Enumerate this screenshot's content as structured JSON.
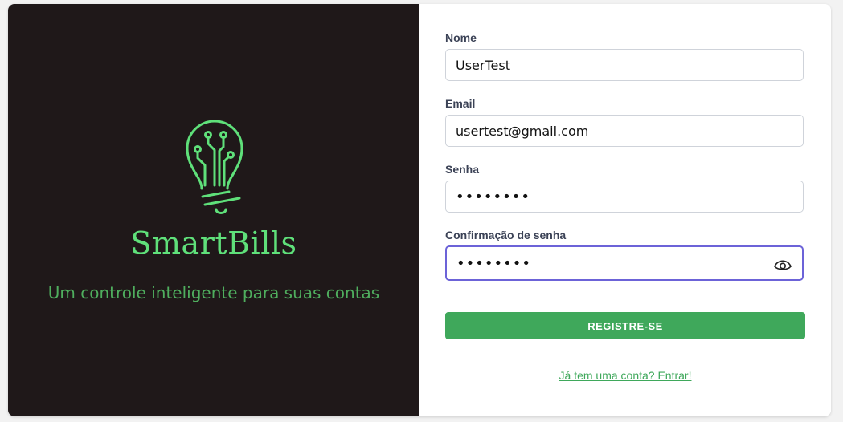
{
  "brand": {
    "name": "SmartBills",
    "tagline": "Um controle inteligente para suas contas",
    "logo_icon": "lightbulb-circuit-icon",
    "background_color": "#1f1819",
    "accent_color": "#5fe07a"
  },
  "form": {
    "fields": [
      {
        "label": "Nome",
        "value": "UserTest",
        "type": "text"
      },
      {
        "label": "Email",
        "value": "usertest@gmail.com",
        "type": "email"
      },
      {
        "label": "Senha",
        "value": "••••••••",
        "type": "password"
      },
      {
        "label": "Confirmação de senha",
        "value": "••••••••",
        "type": "password",
        "focused": true,
        "show_password_icon": "eye-icon"
      }
    ],
    "submit_label": "REGISTRE-SE",
    "login_link": "Já tem uma conta? Entrar!",
    "button_color": "#3fa85b",
    "focus_color": "#6c63d8"
  }
}
